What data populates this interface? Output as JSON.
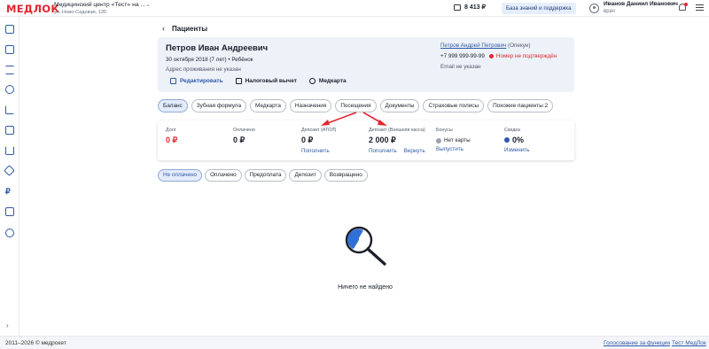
{
  "header": {
    "logo": "МЕДЛОК",
    "clinic_name": "Медицинский центр «Тест» на ...",
    "clinic_address": "ул. Ново-Садовая, 135",
    "balance": "8 413 ₽",
    "kb_button": "База знаний и поддержка",
    "user_name": "Иванов Даниил Иванович",
    "user_role": "врач"
  },
  "page": {
    "title": "Пациенты"
  },
  "patient": {
    "name": "Петров Иван Андреевич",
    "dob": "30 октября 2018 (7 лет) • Ребёнок",
    "address": "Адрес проживания не указан",
    "guardian_name": "Петров Андрей Петрович",
    "guardian_role": "(Опекун)",
    "phone": "+7 999 999-99-99",
    "phone_warning": "Номер не подтверждён",
    "email": "Email не указан",
    "actions": {
      "edit": "Редактировать",
      "tax": "Налоговый вычет",
      "medcard": "Медкарта"
    }
  },
  "tabs": [
    "Баланс",
    "Зубная формула",
    "Медкарта",
    "Назначения",
    "Посещения",
    "Документы",
    "Страховые полисы",
    "Похожие пациенты 2"
  ],
  "balance": {
    "debt": {
      "label": "Долг",
      "value": "0 ₽"
    },
    "paid": {
      "label": "Оплачено",
      "value": "0 ₽"
    },
    "deposit_atol": {
      "label": "Депозит (АТОЛ)",
      "value": "0 ₽",
      "link": "Пополнить"
    },
    "deposit_ext": {
      "label": "Депозит (Внешняя касса)",
      "value": "2 000 ₽",
      "link1": "Пополнить",
      "link2": "Вернуть"
    },
    "bonus": {
      "label": "Бонусы",
      "value": "Нет карты",
      "link": "Выпустить"
    },
    "discount": {
      "label": "Скидка",
      "value": "0%",
      "link": "Изменить"
    }
  },
  "filters": [
    "Не оплачено",
    "Оплачено",
    "Предоплата",
    "Депозит",
    "Возвращено"
  ],
  "empty": {
    "text": "Ничего не найдено"
  },
  "footer": {
    "copyright": "2011–2026 © медрокет",
    "link1": "Голосование за функции",
    "link2": "Тест МедЛок"
  },
  "colors": {
    "accent": "#2f5aa8",
    "danger": "#e3262f",
    "card_bg": "#edf1f8"
  },
  "icons": [
    "home-icon",
    "calendar-icon",
    "list-icon",
    "users-icon",
    "chart-icon",
    "flask-icon",
    "bed-icon",
    "box-icon",
    "ruble-icon",
    "puzzle-icon",
    "settings-icon"
  ]
}
